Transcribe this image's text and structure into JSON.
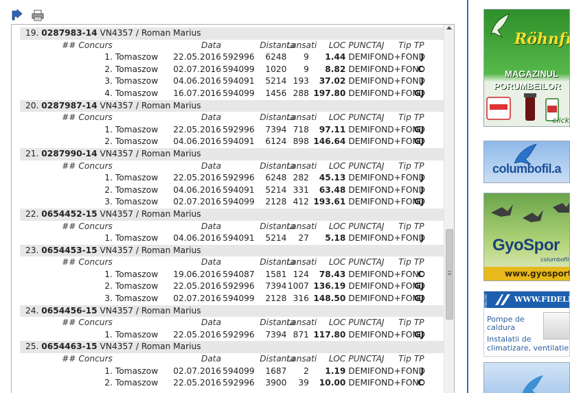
{
  "toolbar": {
    "export_icon": "export-arrow-icon",
    "print_icon": "printer-icon"
  },
  "columns": {
    "nr": "## Concurs",
    "date": "Data",
    "dist": "Distanta",
    "lans": "Lansati",
    "loc": "LOC",
    "pts": "PUNCTAJ",
    "tip": "Tip",
    "tp": "TP"
  },
  "birds": [
    {
      "index": "19.",
      "ring": "0287983-14",
      "owner": "VN4357 / Roman Marius",
      "races": [
        {
          "nr": "1.",
          "place": "Tomaszow",
          "date": "22.05.2016",
          "code": "592996",
          "dist": "",
          "lans": "6248",
          "loc": "9",
          "pts": "1.44",
          "cat": "DEMIFOND+FOND",
          "tip": "J"
        },
        {
          "nr": "2.",
          "place": "Tomaszow",
          "date": "02.07.2016",
          "code": "594099",
          "dist": "",
          "lans": "1020",
          "loc": "9",
          "pts": "8.82",
          "cat": "DEMIFOND+FOND",
          "tip": "C"
        },
        {
          "nr": "3.",
          "place": "Tomaszow",
          "date": "04.06.2016",
          "code": "594091",
          "dist": "",
          "lans": "5214",
          "loc": "193",
          "pts": "37.02",
          "cat": "DEMIFOND+FOND",
          "tip": "J"
        },
        {
          "nr": "4.",
          "place": "Tomaszow",
          "date": "16.07.2016",
          "code": "594099",
          "dist": "",
          "lans": "1456",
          "loc": "288",
          "pts": "197.80",
          "cat": "DEMIFOND+FOND",
          "tip": "GJ"
        }
      ]
    },
    {
      "index": "20.",
      "ring": "0287987-14",
      "owner": "VN4357 / Roman Marius",
      "races": [
        {
          "nr": "1.",
          "place": "Tomaszow",
          "date": "22.05.2016",
          "code": "592996",
          "dist": "",
          "lans": "7394",
          "loc": "718",
          "pts": "97.11",
          "cat": "DEMIFOND+FOND",
          "tip": "GJ"
        },
        {
          "nr": "2.",
          "place": "Tomaszow",
          "date": "04.06.2016",
          "code": "594091",
          "dist": "",
          "lans": "6124",
          "loc": "898",
          "pts": "146.64",
          "cat": "DEMIFOND+FOND",
          "tip": "GJ"
        }
      ]
    },
    {
      "index": "21.",
      "ring": "0287990-14",
      "owner": "VN4357 / Roman Marius",
      "races": [
        {
          "nr": "1.",
          "place": "Tomaszow",
          "date": "22.05.2016",
          "code": "592996",
          "dist": "",
          "lans": "6248",
          "loc": "282",
          "pts": "45.13",
          "cat": "DEMIFOND+FOND",
          "tip": "J"
        },
        {
          "nr": "2.",
          "place": "Tomaszow",
          "date": "04.06.2016",
          "code": "594091",
          "dist": "",
          "lans": "5214",
          "loc": "331",
          "pts": "63.48",
          "cat": "DEMIFOND+FOND",
          "tip": "J"
        },
        {
          "nr": "3.",
          "place": "Tomaszow",
          "date": "02.07.2016",
          "code": "594099",
          "dist": "",
          "lans": "2128",
          "loc": "412",
          "pts": "193.61",
          "cat": "DEMIFOND+FOND",
          "tip": "GJ"
        }
      ]
    },
    {
      "index": "22.",
      "ring": "0654452-15",
      "owner": "VN4357 / Roman Marius",
      "races": [
        {
          "nr": "1.",
          "place": "Tomaszow",
          "date": "04.06.2016",
          "code": "594091",
          "dist": "",
          "lans": "5214",
          "loc": "27",
          "pts": "5.18",
          "cat": "DEMIFOND+FOND",
          "tip": "J"
        }
      ]
    },
    {
      "index": "23.",
      "ring": "0654453-15",
      "owner": "VN4357 / Roman Marius",
      "races": [
        {
          "nr": "1.",
          "place": "Tomaszow",
          "date": "19.06.2016",
          "code": "594087",
          "dist": "",
          "lans": "1581",
          "loc": "124",
          "pts": "78.43",
          "cat": "DEMIFOND+FOND",
          "tip": "C"
        },
        {
          "nr": "2.",
          "place": "Tomaszow",
          "date": "22.05.2016",
          "code": "592996",
          "dist": "",
          "lans": "7394",
          "loc": "1007",
          "pts": "136.19",
          "cat": "DEMIFOND+FOND",
          "tip": "GJ"
        },
        {
          "nr": "3.",
          "place": "Tomaszow",
          "date": "02.07.2016",
          "code": "594099",
          "dist": "",
          "lans": "2128",
          "loc": "316",
          "pts": "148.50",
          "cat": "DEMIFOND+FOND",
          "tip": "GJ"
        }
      ]
    },
    {
      "index": "24.",
      "ring": "0654456-15",
      "owner": "VN4357 / Roman Marius",
      "races": [
        {
          "nr": "1.",
          "place": "Tomaszow",
          "date": "22.05.2016",
          "code": "592996",
          "dist": "",
          "lans": "7394",
          "loc": "871",
          "pts": "117.80",
          "cat": "DEMIFOND+FOND",
          "tip": "GJ"
        }
      ]
    },
    {
      "index": "25.",
      "ring": "0654463-15",
      "owner": "VN4357 / Roman Marius",
      "races": [
        {
          "nr": "1.",
          "place": "Tomaszow",
          "date": "02.07.2016",
          "code": "594099",
          "dist": "",
          "lans": "1687",
          "loc": "2",
          "pts": "1.19",
          "cat": "DEMIFOND+FOND",
          "tip": "J"
        },
        {
          "nr": "2.",
          "place": "Tomaszow",
          "date": "22.05.2016",
          "code": "592996",
          "dist": "",
          "lans": "3900",
          "loc": "39",
          "pts": "10.00",
          "cat": "DEMIFOND+FOND",
          "tip": "C"
        }
      ]
    }
  ],
  "ads": {
    "rohnfried": {
      "brand": "Röhnfri",
      "line1": "MAGAZINUL",
      "line2": "PORUMBEILOR",
      "click": "click"
    },
    "columbofil": {
      "text": "columbofil.a"
    },
    "gyosport": {
      "logo": "GyoSpor",
      "tag": "columbofil",
      "url": "www.gyosport.ro"
    },
    "fidelitas": {
      "band": "WWW.FIDELITA",
      "side": "FIDELITAS",
      "line1": "Pompe de caldura",
      "line2": "Instalatii de climatizare, ventilatie"
    }
  },
  "colors": {
    "accent": "#3b6aa8",
    "header_row": "#e7e7e7"
  }
}
